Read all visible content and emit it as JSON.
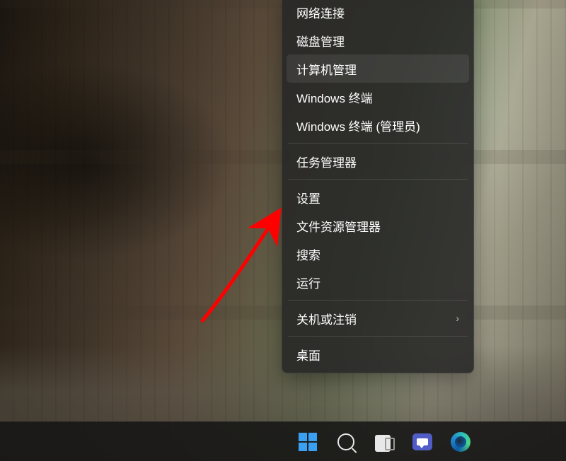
{
  "context_menu": {
    "items": [
      {
        "label": "网络连接",
        "separator_after": false,
        "hovered": false,
        "submenu": false
      },
      {
        "label": "磁盘管理",
        "separator_after": false,
        "hovered": false,
        "submenu": false
      },
      {
        "label": "计算机管理",
        "separator_after": false,
        "hovered": true,
        "submenu": false
      },
      {
        "label": "Windows 终端",
        "separator_after": false,
        "hovered": false,
        "submenu": false
      },
      {
        "label": "Windows 终端 (管理员)",
        "separator_after": true,
        "hovered": false,
        "submenu": false
      },
      {
        "label": "任务管理器",
        "separator_after": true,
        "hovered": false,
        "submenu": false
      },
      {
        "label": "设置",
        "separator_after": false,
        "hovered": false,
        "submenu": false
      },
      {
        "label": "文件资源管理器",
        "separator_after": false,
        "hovered": false,
        "submenu": false
      },
      {
        "label": "搜索",
        "separator_after": false,
        "hovered": false,
        "submenu": false
      },
      {
        "label": "运行",
        "separator_after": true,
        "hovered": false,
        "submenu": false
      },
      {
        "label": "关机或注销",
        "separator_after": true,
        "hovered": false,
        "submenu": true
      },
      {
        "label": "桌面",
        "separator_after": false,
        "hovered": false,
        "submenu": false
      }
    ]
  },
  "taskbar": {
    "buttons": [
      {
        "name": "start-button",
        "icon": "windows-logo-icon"
      },
      {
        "name": "search-button",
        "icon": "search-icon"
      },
      {
        "name": "task-view-button",
        "icon": "task-view-icon"
      },
      {
        "name": "chat-button",
        "icon": "chat-icon"
      },
      {
        "name": "edge-button",
        "icon": "edge-icon"
      }
    ]
  },
  "annotation": {
    "type": "arrow",
    "color": "#ff0000",
    "points_to": "设置"
  }
}
